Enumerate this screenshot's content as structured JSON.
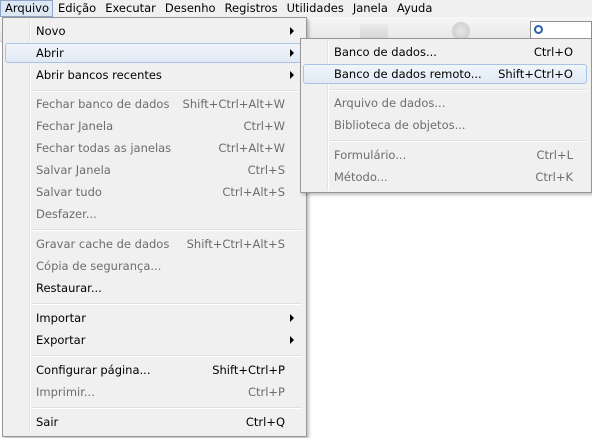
{
  "menubar": {
    "items": [
      {
        "label": "Arquivo"
      },
      {
        "label": "Edição"
      },
      {
        "label": "Executar"
      },
      {
        "label": "Desenho"
      },
      {
        "label": "Registros"
      },
      {
        "label": "Utilidades"
      },
      {
        "label": "Janela"
      },
      {
        "label": "Ayuda"
      }
    ]
  },
  "file_menu": {
    "items": [
      {
        "label": "Novo",
        "shortcut": ""
      },
      {
        "label": "Abrir",
        "shortcut": ""
      },
      {
        "label": "Abrir bancos recentes",
        "shortcut": ""
      },
      {
        "label": "Fechar banco de dados",
        "shortcut": "Shift+Ctrl+Alt+W"
      },
      {
        "label": "Fechar Janela",
        "shortcut": "Ctrl+W"
      },
      {
        "label": "Fechar todas as janelas",
        "shortcut": "Ctrl+Alt+W"
      },
      {
        "label": "Salvar Janela",
        "shortcut": "Ctrl+S"
      },
      {
        "label": "Salvar tudo",
        "shortcut": "Ctrl+Alt+S"
      },
      {
        "label": "Desfazer...",
        "shortcut": ""
      },
      {
        "label": "Gravar cache de dados",
        "shortcut": "Shift+Ctrl+Alt+S"
      },
      {
        "label": "Cópia de segurança...",
        "shortcut": ""
      },
      {
        "label": "Restaurar...",
        "shortcut": ""
      },
      {
        "label": "Importar",
        "shortcut": ""
      },
      {
        "label": "Exportar",
        "shortcut": ""
      },
      {
        "label": "Configurar página...",
        "shortcut": "Shift+Ctrl+P"
      },
      {
        "label": "Imprimir...",
        "shortcut": "Ctrl+P"
      },
      {
        "label": "Sair",
        "shortcut": "Ctrl+Q"
      }
    ]
  },
  "open_submenu": {
    "items": [
      {
        "label": "Banco de dados...",
        "shortcut": "Ctrl+O"
      },
      {
        "label": "Banco de dados remoto...",
        "shortcut": "Shift+Ctrl+O"
      },
      {
        "label": "Arquivo de dados...",
        "shortcut": ""
      },
      {
        "label": "Biblioteca de objetos...",
        "shortcut": ""
      },
      {
        "label": "Formulário...",
        "shortcut": "Ctrl+L"
      },
      {
        "label": "Método...",
        "shortcut": "Ctrl+K"
      }
    ]
  },
  "icons": {
    "submenu_arrow": "chevron-right-icon",
    "search": "search-icon"
  }
}
